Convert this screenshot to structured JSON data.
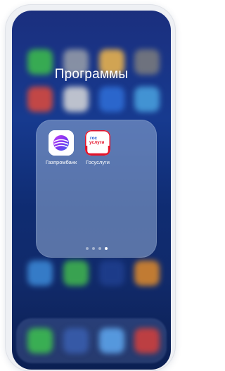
{
  "folder": {
    "title": "Программы",
    "apps": [
      {
        "name": "gazprombank",
        "label": "Газпромбанк",
        "icon": "gazprombank-icon",
        "accent": "#8a2be2"
      },
      {
        "name": "gosuslugi",
        "label": "Госуслуги",
        "icon": "gosuslugi-icon",
        "accent": "#e4132a",
        "icon_text_top": "гос",
        "icon_text_bottom": "услуги"
      }
    ],
    "pages": 4,
    "active_page": 4
  },
  "colors": {
    "wallpaper": "#173a8f",
    "gosuslugi_red": "#e4132a",
    "gosuslugi_blue": "#1c56d4"
  }
}
